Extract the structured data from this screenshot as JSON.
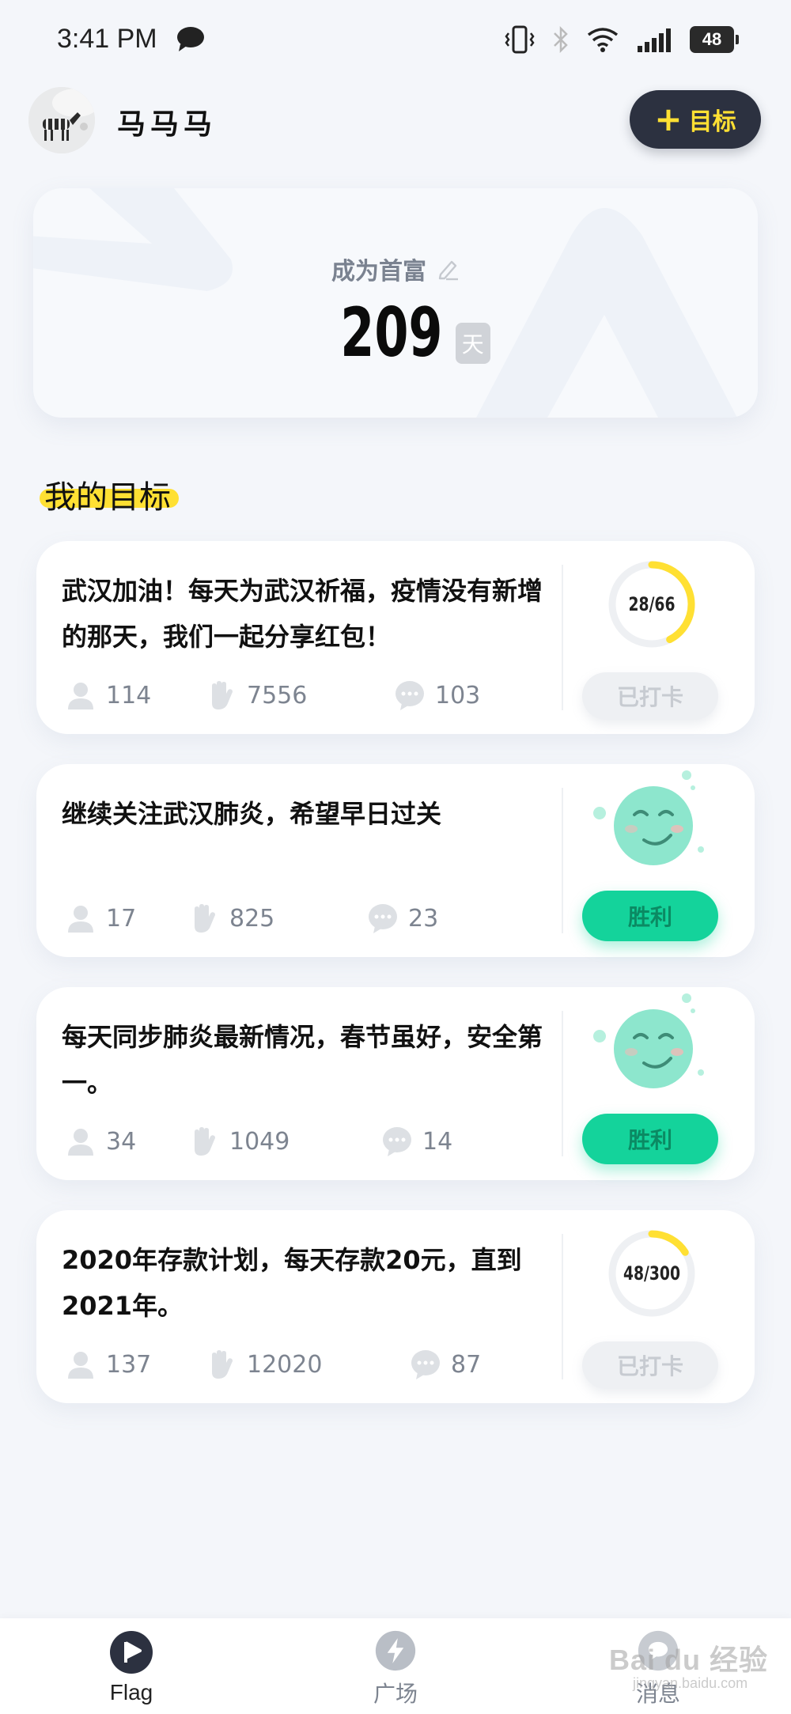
{
  "status_bar": {
    "time": "3:41 PM",
    "battery": "48",
    "icons": [
      "message-bubble-icon",
      "vibrate-icon",
      "bluetooth-icon",
      "wifi-icon",
      "signal-icon",
      "battery-icon"
    ]
  },
  "header": {
    "username": "马马马",
    "add_goal_plus": "+",
    "add_goal_label": "目标"
  },
  "hero": {
    "title": "成为首富",
    "count": "209",
    "unit": "天"
  },
  "section": {
    "title": "我的目标"
  },
  "goals": [
    {
      "text": "武汉加油！每天为武汉祈福，疫情没有新增的那天，我们一起分享红包！",
      "members": "114",
      "claps": "7556",
      "comments": "103",
      "progress_label": "28/66",
      "progress_done": 28,
      "progress_total": 66,
      "status": "已打卡"
    },
    {
      "text": "继续关注武汉肺炎，希望早日过关",
      "members": "17",
      "claps": "825",
      "comments": "23",
      "status": "胜利"
    },
    {
      "text": "每天同步肺炎最新情况，春节虽好，安全第一。",
      "members": "34",
      "claps": "1049",
      "comments": "14",
      "status": "胜利"
    },
    {
      "text": "2020年存款计划，每天存款20元，直到2021年。",
      "members": "137",
      "claps": "12020",
      "comments": "87",
      "progress_label": "48/300",
      "progress_done": 48,
      "progress_total": 300,
      "status": "已打卡"
    }
  ],
  "bottom_nav": {
    "items": [
      {
        "label": "Flag",
        "icon": "flag-play-icon",
        "active": true
      },
      {
        "label": "广场",
        "icon": "lightning-icon",
        "active": false
      },
      {
        "label": "消息",
        "icon": "message-icon",
        "active": false
      }
    ]
  },
  "watermark": {
    "text": "Bai du 经验",
    "sub": "jingyan.baidu.com"
  },
  "colors": {
    "accent_yellow": "#ffe033",
    "win_green": "#14d39b",
    "dark_button": "#2c3140",
    "ring_track": "#eef0f3"
  }
}
